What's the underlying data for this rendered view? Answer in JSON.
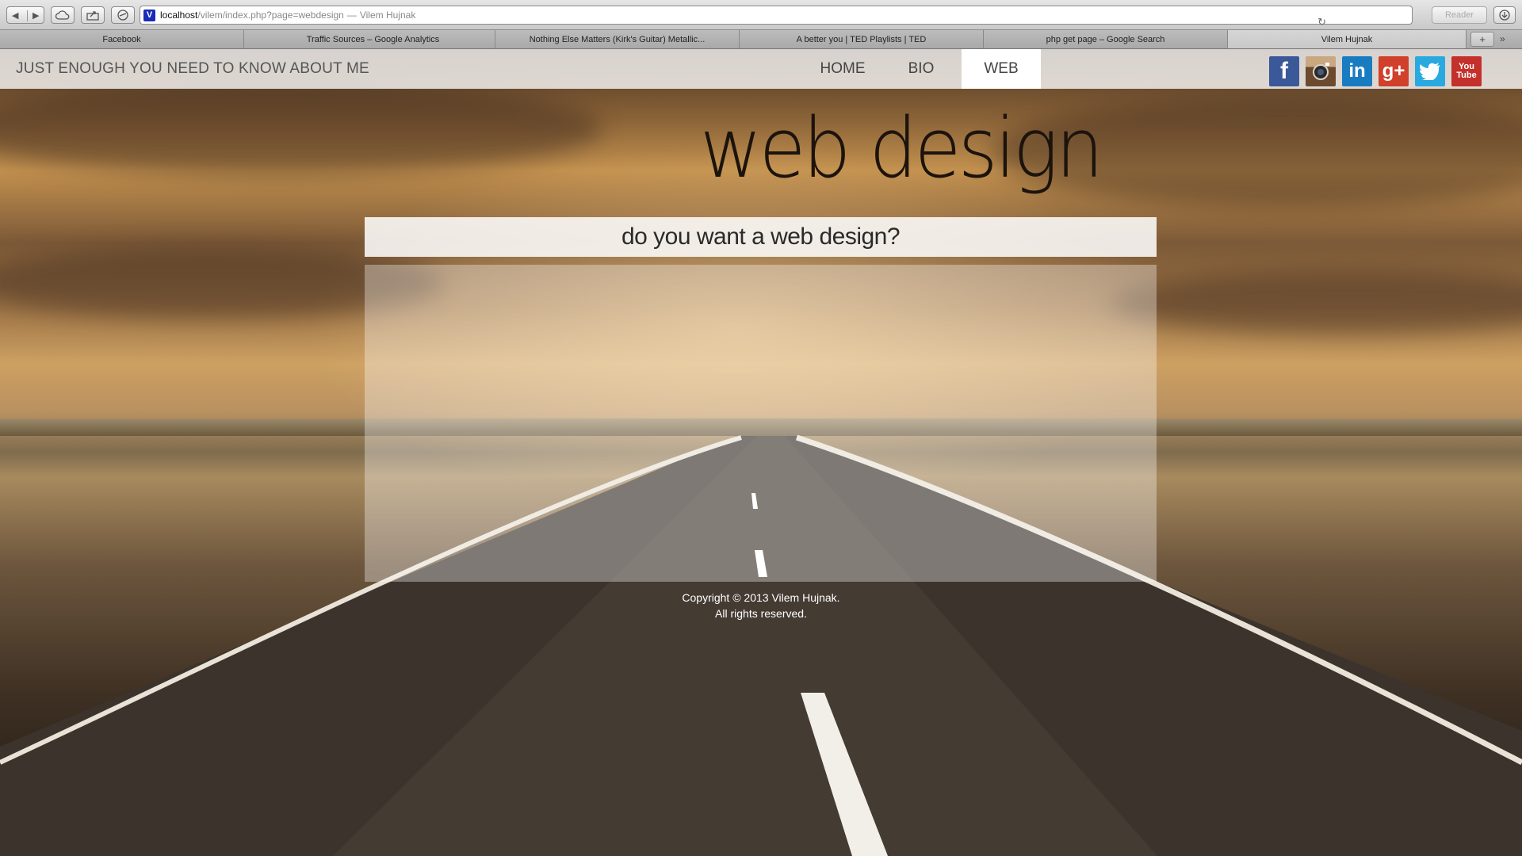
{
  "browser": {
    "url_host": "localhost",
    "url_path": "/vilem/index.php?page=webdesign",
    "url_separator": "—",
    "page_title": "Vilem Hujnak",
    "favicon_letter": "V",
    "reader_label": "Reader",
    "tabs": [
      {
        "label": "Facebook"
      },
      {
        "label": "Traffic Sources – Google Analytics"
      },
      {
        "label": "Nothing Else Matters (Kirk's Guitar) Metallic..."
      },
      {
        "label": "A better you | TED Playlists | TED"
      },
      {
        "label": "php get page – Google Search"
      },
      {
        "label": "Vilem Hujnak"
      }
    ],
    "tab_add_label": "+",
    "tab_overflow_label": "»"
  },
  "site": {
    "tagline": "JUST ENOUGH YOU NEED TO KNOW ABOUT ME",
    "nav": [
      {
        "label": "HOME"
      },
      {
        "label": "BIO"
      },
      {
        "label": "WEB",
        "active": true
      }
    ],
    "social": [
      {
        "name": "facebook-icon",
        "glyph": "f",
        "color": "#3b5998"
      },
      {
        "name": "instagram-icon",
        "glyph": "",
        "color": "#6b4a2f"
      },
      {
        "name": "linkedin-icon",
        "glyph": "in",
        "color": "#1a7cc0"
      },
      {
        "name": "google-plus-icon",
        "glyph": "g+",
        "color": "#d0402a"
      },
      {
        "name": "twitter-icon",
        "glyph": "",
        "color": "#2aa9e0"
      },
      {
        "name": "youtube-icon",
        "glyph_top": "You",
        "glyph_bottom": "Tube",
        "color": "#c4302b"
      }
    ],
    "hero_title": "web design",
    "subheading": "do you want a web design?",
    "footer_line1": "Copyright © 2013 Vilem Hujnak.",
    "footer_line2": "All rights reserved."
  }
}
